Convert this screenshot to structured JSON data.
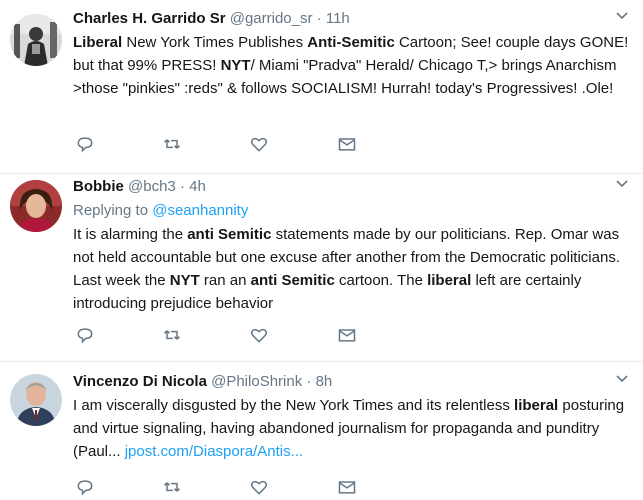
{
  "tweets": [
    {
      "name": "Charles H. Garrido Sr",
      "handle": "@garrido_sr",
      "dot": "·",
      "time": "11h",
      "segments": [
        {
          "text": "Liberal",
          "bold": true
        },
        {
          "text": " New York Times Publishes ",
          "bold": false
        },
        {
          "text": "Anti-Semitic",
          "bold": true
        },
        {
          "text": " Cartoon;  See! couple days GONE! but that  99% PRESS!  ",
          "bold": false
        },
        {
          "text": "NYT",
          "bold": true
        },
        {
          "text": "/ Miami \"Pradva\" Herald/ Chicago T,>  brings Anarchism >those \"pinkies\" :reds\" & follows  SOCIALISM! Hurrah! today's Progressives! .Ole!",
          "bold": false
        }
      ]
    },
    {
      "name": "Bobbie",
      "handle": "@bch3",
      "dot": "·",
      "time": "4h",
      "reply_prefix": "Replying to",
      "reply_to": "@seanhannity",
      "segments": [
        {
          "text": "It is alarming the ",
          "bold": false
        },
        {
          "text": "anti Semitic",
          "bold": true
        },
        {
          "text": " statements made by our politicians.  Rep. Omar was not held accountable but one excuse after another from the Democratic politicians.  Last week the ",
          "bold": false
        },
        {
          "text": "NYT",
          "bold": true
        },
        {
          "text": " ran an ",
          "bold": false
        },
        {
          "text": "anti Semitic",
          "bold": true
        },
        {
          "text": " cartoon.  The ",
          "bold": false
        },
        {
          "text": "liberal",
          "bold": true
        },
        {
          "text": " left are certainly introducing prejudice behavior",
          "bold": false
        }
      ]
    },
    {
      "name": "Vincenzo Di Nicola",
      "handle": "@PhiloShrink",
      "dot": "·",
      "time": "8h",
      "segments": [
        {
          "text": "I am viscerally disgusted by the New York Times and its relentless ",
          "bold": false
        },
        {
          "text": "liberal",
          "bold": true
        },
        {
          "text": " posturing and virtue signaling, having abandoned journalism for propaganda and punditry (Paul... ",
          "bold": false
        }
      ],
      "link": "jpost.com/Diaspora/Antis..."
    }
  ],
  "icons": {
    "caret": "chevron-down-icon",
    "reply": "reply-icon",
    "retweet": "retweet-icon",
    "like": "heart-icon",
    "dm": "envelope-icon"
  },
  "colors": {
    "link": "#1da1f2",
    "secondary": "#657786",
    "text": "#14171a",
    "divider": "#e6ecf0"
  }
}
